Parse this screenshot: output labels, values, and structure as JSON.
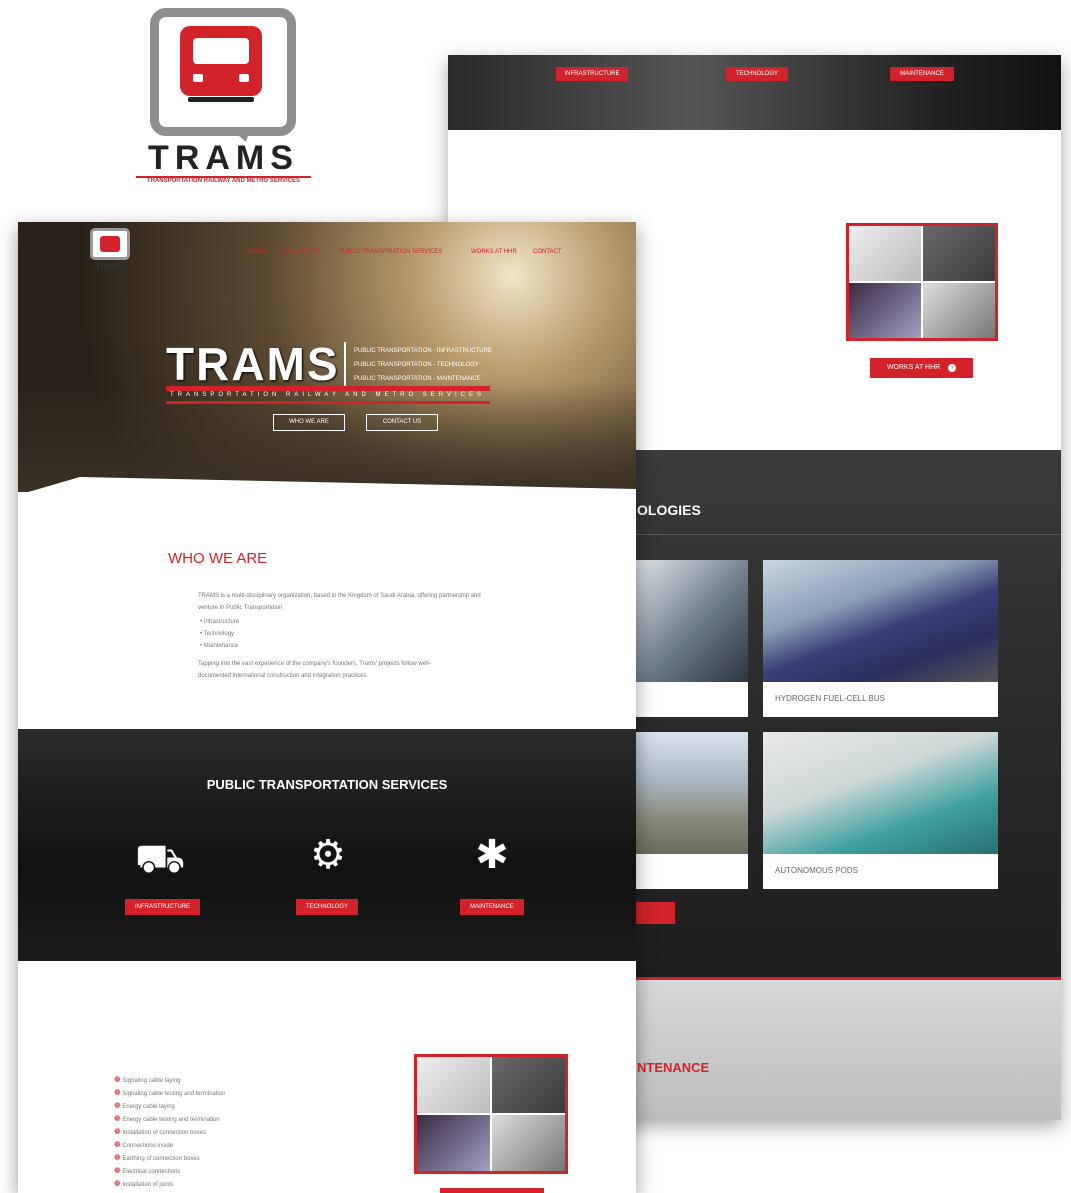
{
  "logo": {
    "word": "TRAMS",
    "subtitle": "TRANSPORTATION RAILWAY AND METRO SERVICES"
  },
  "back_page": {
    "top_buttons": [
      "INFRASTRUCTURE",
      "TECHNOLOGY",
      "MAINTENANCE"
    ],
    "works_button": "WORKS AT HHR",
    "works_icon": "chevron-right-circle-icon",
    "technologies_title": "OLOGIES",
    "cards": [
      {
        "label": "HYDROGEN FUEL-CELL BUS"
      },
      {
        "label": "AUTONOMOUS PODS"
      }
    ],
    "maintenance_title": "NTENANCE",
    "colors": {
      "accent": "#d2232a",
      "dark": "#2a2a2a"
    }
  },
  "front_page": {
    "nav": [
      "HOME",
      "WHO WE ARE",
      "PUBLIC TRANSPIRATION SERVICES",
      "WORKS AT HHR",
      "CONTACT"
    ],
    "nav_logo_word": "TRAMS",
    "hero_word": "TRAMS",
    "hero_lines": [
      "PUBLIC TRANSPORTATION - INFRASTRUCTURE",
      "PUBLIC TRANSPORTATION - TECHNOLOGY",
      "PUBLIC TRANSPORTATION - MAINTENANCE"
    ],
    "hero_sub": "TRANSPORTATION RAILWAY AND METRO SERVICES",
    "hero_buttons": [
      "WHO WE ARE",
      "CONTACT US"
    ],
    "who_title": "WHO WE ARE",
    "who_paragraph": "TRAMS is a multi-disciplinary organization, based in the Kingdom of Saudi Arabia, offering partnership and venture in Public Transportation",
    "who_list": [
      "Infrastructure",
      "Technology",
      "Maintenance"
    ],
    "who_paragraph2": "Tapping into the vast experience of the company's founders, Trams' projects follow well-documented international construction and integration practices.",
    "services_title": "PUBLIC TRANSPORTATION SERVICES",
    "services": [
      {
        "label": "INFRASTRUCTURE",
        "icon": "railway-icon"
      },
      {
        "label": "TECHNOLOGY",
        "icon": "lightbulb-gear-icon"
      },
      {
        "label": "MAINTENANCE",
        "icon": "wrench-gear-icon"
      }
    ],
    "infra_list": [
      "Signaling cable laying",
      "Signaling cable testing and termination",
      "Energy cable laying",
      "Energy cable testing and termination",
      "Installation of connection boxes",
      "Connections inside",
      "Earthing of connection boxes",
      "Electrical connections",
      "Installation of joints"
    ]
  }
}
